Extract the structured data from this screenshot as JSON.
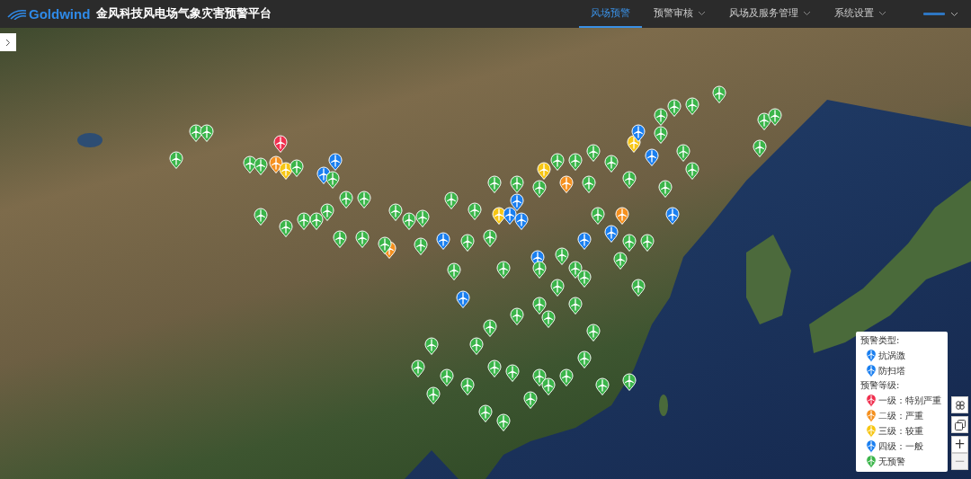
{
  "header": {
    "brand": "Goldwind",
    "title": "金风科技风电场气象灾害预警平台"
  },
  "nav": [
    {
      "label": "风场预警",
      "selected": true,
      "dropdown": false
    },
    {
      "label": "预警审核",
      "selected": false,
      "dropdown": true
    },
    {
      "label": "风场及服务管理",
      "selected": false,
      "dropdown": true
    },
    {
      "label": "系统设置",
      "selected": false,
      "dropdown": true
    }
  ],
  "legend": {
    "sections": [
      {
        "title": "预警类型:",
        "items": [
          {
            "label": "抗涡激",
            "color": "#1a7ff0"
          },
          {
            "label": "防扫塔",
            "color": "#1a7ff0"
          }
        ]
      },
      {
        "title": "预警等级:",
        "items": [
          {
            "label": "一级：特别严重",
            "color": "#f0304f"
          },
          {
            "label": "二级：严重",
            "color": "#f5901e"
          },
          {
            "label": "三级：较重",
            "color": "#f7c614"
          },
          {
            "label": "四级：一般",
            "color": "#1a7ff0"
          },
          {
            "label": "无预警",
            "color": "#3bb54a"
          }
        ]
      }
    ]
  },
  "zoom": {
    "in": "+",
    "out": "−"
  },
  "markers": [
    {
      "color": "#f0304f"
    },
    {
      "color": "#f5901e"
    },
    {
      "color": "#f5901e"
    },
    {
      "color": "#f5901e"
    },
    {
      "color": "#f5901e"
    },
    {
      "color": "#f7c614"
    },
    {
      "color": "#f7c614"
    },
    {
      "color": "#f7c614"
    },
    {
      "color": "#f7c614"
    },
    {
      "color": "#1a7ff0"
    },
    {
      "color": "#1a7ff0"
    },
    {
      "color": "#1a7ff0"
    },
    {
      "color": "#1a7ff0"
    },
    {
      "color": "#1a7ff0"
    },
    {
      "color": "#1a7ff0"
    },
    {
      "color": "#1a7ff0"
    },
    {
      "color": "#1a7ff0"
    },
    {
      "color": "#1a7ff0"
    },
    {
      "color": "#1a7ff0"
    },
    {
      "color": "#1a7ff0"
    },
    {
      "color": "#1a7ff0"
    },
    {
      "color": "#1a7ff0"
    },
    {
      "color": "#3bb54a"
    },
    {
      "color": "#3bb54a"
    },
    {
      "color": "#3bb54a"
    },
    {
      "color": "#3bb54a"
    },
    {
      "color": "#3bb54a"
    },
    {
      "color": "#3bb54a"
    },
    {
      "color": "#3bb54a"
    },
    {
      "color": "#3bb54a"
    },
    {
      "color": "#3bb54a"
    },
    {
      "color": "#3bb54a"
    },
    {
      "color": "#3bb54a"
    },
    {
      "color": "#3bb54a"
    },
    {
      "color": "#3bb54a"
    },
    {
      "color": "#3bb54a"
    },
    {
      "color": "#3bb54a"
    },
    {
      "color": "#3bb54a"
    },
    {
      "color": "#3bb54a"
    },
    {
      "color": "#3bb54a"
    },
    {
      "color": "#3bb54a"
    },
    {
      "color": "#3bb54a"
    },
    {
      "color": "#3bb54a"
    },
    {
      "color": "#3bb54a"
    },
    {
      "color": "#3bb54a"
    },
    {
      "color": "#3bb54a"
    },
    {
      "color": "#3bb54a"
    },
    {
      "color": "#3bb54a"
    },
    {
      "color": "#3bb54a"
    },
    {
      "color": "#3bb54a"
    },
    {
      "color": "#3bb54a"
    },
    {
      "color": "#3bb54a"
    },
    {
      "color": "#3bb54a"
    },
    {
      "color": "#3bb54a"
    },
    {
      "color": "#3bb54a"
    },
    {
      "color": "#3bb54a"
    },
    {
      "color": "#3bb54a"
    },
    {
      "color": "#3bb54a"
    },
    {
      "color": "#3bb54a"
    },
    {
      "color": "#3bb54a"
    },
    {
      "color": "#3bb54a"
    },
    {
      "color": "#3bb54a"
    },
    {
      "color": "#3bb54a"
    },
    {
      "color": "#3bb54a"
    },
    {
      "color": "#3bb54a"
    },
    {
      "color": "#3bb54a"
    },
    {
      "color": "#3bb54a"
    },
    {
      "color": "#3bb54a"
    },
    {
      "color": "#3bb54a"
    },
    {
      "color": "#3bb54a"
    },
    {
      "color": "#3bb54a"
    },
    {
      "color": "#3bb54a"
    },
    {
      "color": "#3bb54a"
    },
    {
      "color": "#3bb54a"
    },
    {
      "color": "#3bb54a"
    },
    {
      "color": "#3bb54a"
    },
    {
      "color": "#3bb54a"
    },
    {
      "color": "#3bb54a"
    },
    {
      "color": "#3bb54a"
    },
    {
      "color": "#3bb54a"
    },
    {
      "color": "#3bb54a"
    },
    {
      "color": "#3bb54a"
    },
    {
      "color": "#3bb54a"
    },
    {
      "color": "#3bb54a"
    },
    {
      "color": "#3bb54a"
    },
    {
      "color": "#3bb54a"
    },
    {
      "color": "#3bb54a"
    },
    {
      "color": "#3bb54a"
    },
    {
      "color": "#3bb54a"
    },
    {
      "color": "#3bb54a"
    },
    {
      "color": "#3bb54a"
    },
    {
      "color": "#3bb54a"
    },
    {
      "color": "#3bb54a"
    },
    {
      "color": "#3bb54a"
    },
    {
      "color": "#3bb54a"
    },
    {
      "color": "#3bb54a"
    },
    {
      "color": "#3bb54a"
    },
    {
      "color": "#3bb54a"
    },
    {
      "color": "#3bb54a"
    },
    {
      "color": "#3bb54a"
    },
    {
      "color": "#3bb54a"
    },
    {
      "color": "#3bb54a"
    }
  ]
}
